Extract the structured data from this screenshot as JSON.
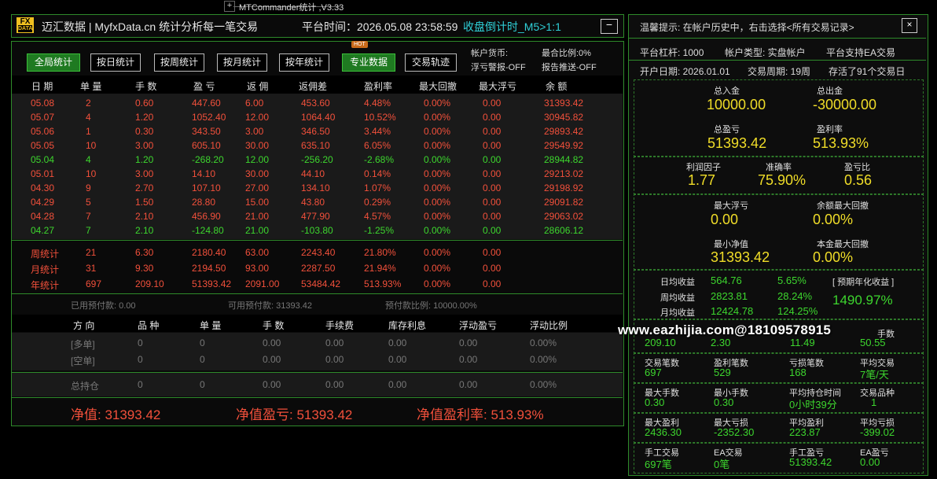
{
  "window": {
    "title": "MTCommander统计 ,V3.33",
    "plus": "+"
  },
  "header": {
    "logo_top": "FX",
    "logo_bottom": "DATA",
    "title": "迈汇数据 | MyfxData.cn  统计分析每一笔交易",
    "platform_time": "平台时间：2026.05.08 23:58:59",
    "countdown": "收盘倒计时_M5>1:1",
    "minimize": "−"
  },
  "toolbar": {
    "buttons": [
      "全局统计",
      "按日统计",
      "按周统计",
      "按月统计",
      "按年统计",
      "专业数据",
      "交易轨迹"
    ],
    "hot_badge": "HOT",
    "account_currency": "帐户货币:",
    "float_warning": "浮亏警报-OFF",
    "max_ratio": "最合比例:0%",
    "report_push": "报告推送-OFF"
  },
  "table": {
    "headers": [
      "日 期",
      "单 量",
      "手 数",
      "盈 亏",
      "返 佣",
      "返佣差",
      "盈利率",
      "最大回撤",
      "最大浮亏",
      "余 额"
    ],
    "rows": [
      [
        "05.08",
        "2",
        "0.60",
        "447.60",
        "6.00",
        "453.60",
        "4.48%",
        "0.00%",
        "0.00",
        "31393.42"
      ],
      [
        "05.07",
        "4",
        "1.20",
        "1052.40",
        "12.00",
        "1064.40",
        "10.52%",
        "0.00%",
        "0.00",
        "30945.82"
      ],
      [
        "05.06",
        "1",
        "0.30",
        "343.50",
        "3.00",
        "346.50",
        "3.44%",
        "0.00%",
        "0.00",
        "29893.42"
      ],
      [
        "05.05",
        "10",
        "3.00",
        "605.10",
        "30.00",
        "635.10",
        "6.05%",
        "0.00%",
        "0.00",
        "29549.92"
      ],
      [
        "05.04",
        "4",
        "1.20",
        "-268.20",
        "12.00",
        "-256.20",
        "-2.68%",
        "0.00%",
        "0.00",
        "28944.82"
      ],
      [
        "05.01",
        "10",
        "3.00",
        "14.10",
        "30.00",
        "44.10",
        "0.14%",
        "0.00%",
        "0.00",
        "29213.02"
      ],
      [
        "04.30",
        "9",
        "2.70",
        "107.10",
        "27.00",
        "134.10",
        "1.07%",
        "0.00%",
        "0.00",
        "29198.92"
      ],
      [
        "04.29",
        "5",
        "1.50",
        "28.80",
        "15.00",
        "43.80",
        "0.29%",
        "0.00%",
        "0.00",
        "29091.82"
      ],
      [
        "04.28",
        "7",
        "2.10",
        "456.90",
        "21.00",
        "477.90",
        "4.57%",
        "0.00%",
        "0.00",
        "29063.02"
      ],
      [
        "04.27",
        "7",
        "2.10",
        "-124.80",
        "21.00",
        "-103.80",
        "-1.25%",
        "0.00%",
        "0.00",
        "28606.12"
      ]
    ],
    "row_negative": [
      false,
      false,
      false,
      false,
      true,
      false,
      false,
      false,
      false,
      true
    ],
    "summary": [
      [
        "周统计",
        "21",
        "6.30",
        "2180.40",
        "63.00",
        "2243.40",
        "21.80%",
        "0.00%",
        "0.00"
      ],
      [
        "月统计",
        "31",
        "9.30",
        "2194.50",
        "93.00",
        "2287.50",
        "21.94%",
        "0.00%",
        "0.00"
      ],
      [
        "年统计",
        "697",
        "209.10",
        "51393.42",
        "2091.00",
        "53484.42",
        "513.93%",
        "0.00%",
        "0.00"
      ]
    ]
  },
  "margin": {
    "used": "已用预付款: 0.00",
    "available": "可用预付款: 31393.42",
    "ratio": "预付款比例: 10000.00%"
  },
  "positions": {
    "headers": [
      "方 向",
      "品 种",
      "单 量",
      "手 数",
      "手续费",
      "库存利息",
      "浮动盈亏",
      "浮动比例"
    ],
    "rows": [
      [
        "[多单]",
        "0",
        "0",
        "0.00",
        "0.00",
        "0.00",
        "0.00",
        "0.00%"
      ],
      [
        "[空单]",
        "0",
        "0",
        "0.00",
        "0.00",
        "0.00",
        "0.00",
        "0.00%"
      ]
    ],
    "total": [
      "总持仓",
      "0",
      "0",
      "0.00",
      "0.00",
      "0.00",
      "0.00",
      "0.00%"
    ]
  },
  "footer": {
    "equity": "净值: 31393.42",
    "equity_pnl": "净值盈亏: 51393.42",
    "equity_rate": "净值盈利率: 513.93%"
  },
  "right": {
    "tip": "温馨提示: 在帐户历史中，右击选择<所有交易记录>",
    "close": "×",
    "leverage": "平台杠杆: 1000",
    "account_type": "帐户类型: 实盘帐户",
    "ea_support": "平台支持EA交易",
    "open_date": "开户日期: 2026.01.01",
    "period": "交易周期: 19周",
    "stored": "存活了91个交易日",
    "total_in_label": "总入金",
    "total_in": "10000.00",
    "total_out_label": "总出金",
    "total_out": "-30000.00",
    "total_pnl_label": "总盈亏",
    "total_pnl": "51393.42",
    "profit_rate_label": "盈利率",
    "profit_rate": "513.93%",
    "profit_factor_label": "利润因子",
    "profit_factor": "1.77",
    "accuracy_label": "准确率",
    "accuracy": "75.90%",
    "pl_ratio_label": "盈亏比",
    "pl_ratio": "0.56",
    "max_float_label": "最大浮亏",
    "max_float": "0.00",
    "max_bal_dd_label": "余额最大回撤",
    "max_bal_dd": "0.00%",
    "min_equity_label": "最小净值",
    "min_equity": "31393.42",
    "max_principal_dd_label": "本金最大回撤",
    "max_principal_dd": "0.00%",
    "daily_label": "日均收益",
    "daily_val": "564.76",
    "daily_pct": "5.65%",
    "weekly_label": "周均收益",
    "weekly_val": "2823.81",
    "weekly_pct": "28.24%",
    "monthly_label": "月均收益",
    "monthly_val": "12424.78",
    "monthly_pct": "124.25%",
    "annual_label": "[ 预期年化收益 ]",
    "annual": "1490.97%",
    "partial_vals": [
      "209.10",
      "2.30",
      "11.49",
      "50.55"
    ],
    "partial_label_tail": "手数",
    "trades_label": "交易笔数",
    "trades": "697",
    "win_trades_label": "盈利笔数",
    "win_trades": "529",
    "loss_trades_label": "亏损笔数",
    "loss_trades": "168",
    "avg_trades_label": "平均交易",
    "avg_trades": "7笔/天",
    "max_lots_label": "最大手数",
    "max_lots": "0.30",
    "min_lots_label": "最小手数",
    "min_lots": "0.30",
    "avg_hold_label": "平均持仓时间",
    "avg_hold": "0小时39分",
    "symbols_label": "交易品种",
    "symbols": "1",
    "max_profit_label": "最大盈利",
    "max_profit": "2436.30",
    "max_loss_label": "最大亏损",
    "max_loss": "-2352.30",
    "avg_profit_label": "平均盈利",
    "avg_profit": "223.87",
    "avg_loss_label": "平均亏损",
    "avg_loss": "-399.02",
    "manual_trades_label": "手工交易",
    "manual_trades": "697笔",
    "ea_trades_label": "EA交易",
    "ea_trades": "0笔",
    "manual_pnl_label": "手工盈亏",
    "manual_pnl": "51393.42",
    "ea_pnl_label": "EA盈亏",
    "ea_pnl": "0.00"
  },
  "watermark": "www.eazhijia.com@18109578915"
}
